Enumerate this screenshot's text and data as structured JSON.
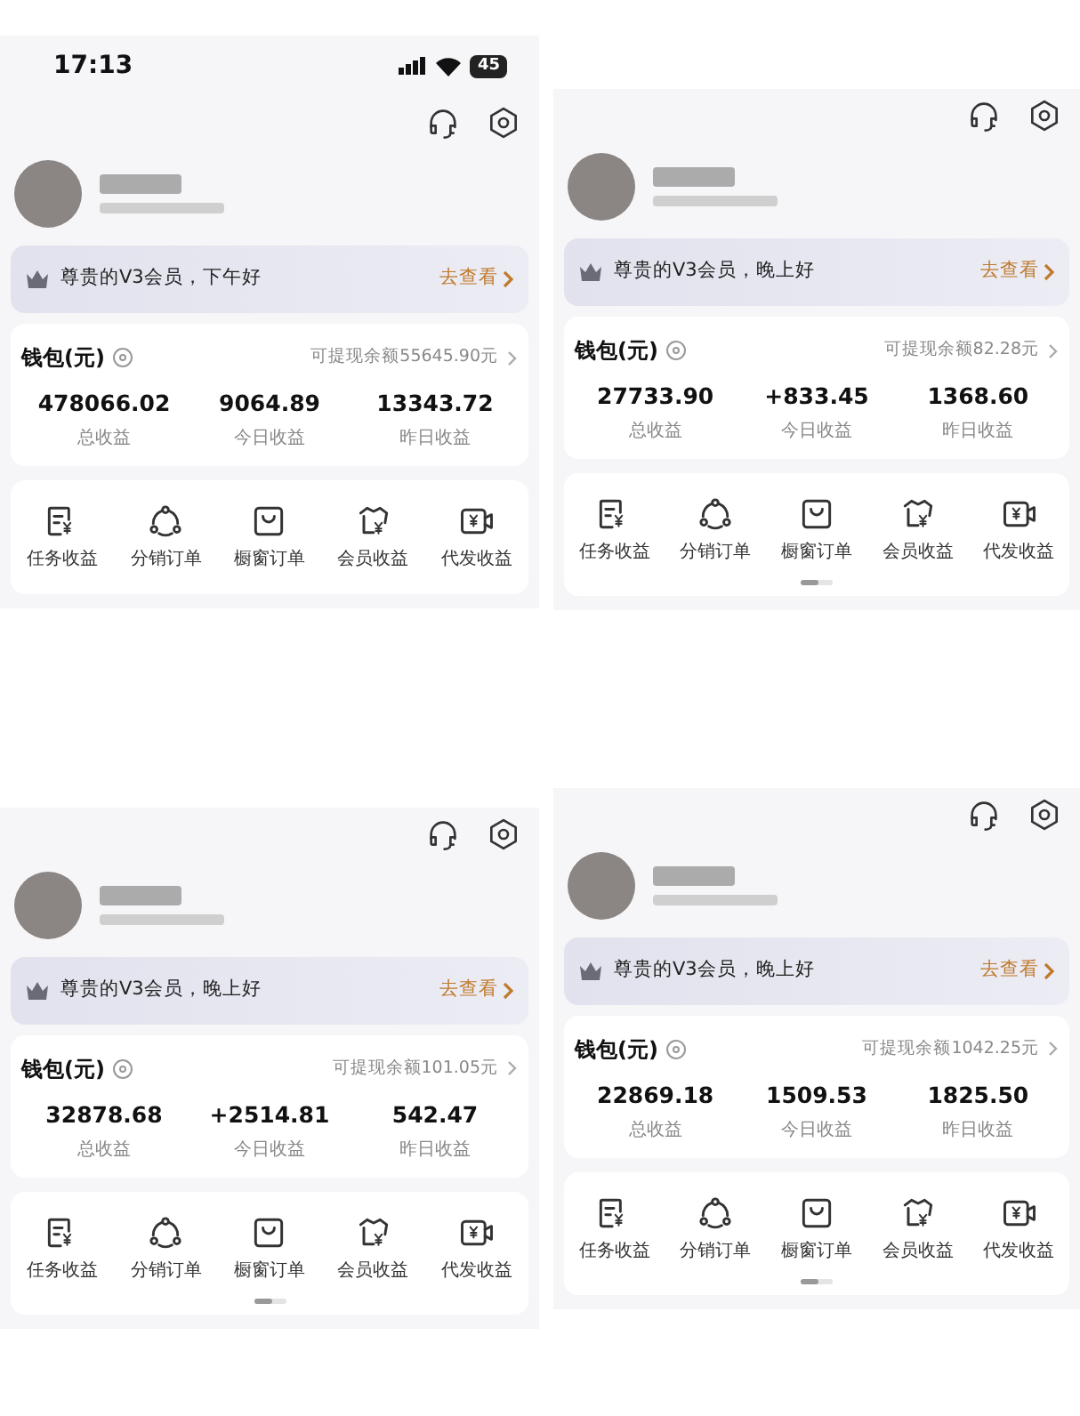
{
  "screens": [
    {
      "status_bar": {
        "time": "17:13",
        "battery": "45"
      },
      "greeting": "尊贵的V3会员，下午好",
      "link": "去查看",
      "wallet": {
        "title": "钱包(元)",
        "withdrawable": "可提现余额55645.90元",
        "stats": [
          {
            "value": "478066.02",
            "label": "总收益"
          },
          {
            "value": "9064.89",
            "label": "今日收益"
          },
          {
            "value": "13343.72",
            "label": "昨日收益"
          }
        ]
      },
      "shortcuts": [
        {
          "kind": "task",
          "label": "任务收益"
        },
        {
          "kind": "distribute",
          "label": "分销订单"
        },
        {
          "kind": "showcase",
          "label": "橱窗订单"
        },
        {
          "kind": "member",
          "label": "会员收益"
        },
        {
          "kind": "delivery",
          "label": "代发收益"
        }
      ],
      "page_indicator": false
    },
    {
      "greeting": "尊贵的V3会员，晚上好",
      "link": "去查看",
      "wallet": {
        "title": "钱包(元)",
        "withdrawable": "可提现余额82.28元",
        "stats": [
          {
            "value": "27733.90",
            "label": "总收益"
          },
          {
            "value": "+833.45",
            "label": "今日收益"
          },
          {
            "value": "1368.60",
            "label": "昨日收益"
          }
        ]
      },
      "shortcuts": [
        {
          "kind": "task",
          "label": "任务收益"
        },
        {
          "kind": "distribute",
          "label": "分销订单"
        },
        {
          "kind": "showcase",
          "label": "橱窗订单"
        },
        {
          "kind": "member",
          "label": "会员收益"
        },
        {
          "kind": "delivery",
          "label": "代发收益"
        }
      ],
      "page_indicator": true
    },
    {
      "greeting": "尊贵的V3会员，晚上好",
      "link": "去查看",
      "wallet": {
        "title": "钱包(元)",
        "withdrawable": "可提现余额101.05元",
        "stats": [
          {
            "value": "32878.68",
            "label": "总收益"
          },
          {
            "value": "+2514.81",
            "label": "今日收益"
          },
          {
            "value": "542.47",
            "label": "昨日收益"
          }
        ]
      },
      "shortcuts": [
        {
          "kind": "task",
          "label": "任务收益"
        },
        {
          "kind": "distribute",
          "label": "分销订单"
        },
        {
          "kind": "showcase",
          "label": "橱窗订单"
        },
        {
          "kind": "member",
          "label": "会员收益"
        },
        {
          "kind": "delivery",
          "label": "代发收益"
        }
      ],
      "page_indicator": true
    },
    {
      "greeting": "尊贵的V3会员，晚上好",
      "link": "去查看",
      "wallet": {
        "title": "钱包(元)",
        "withdrawable": "可提现余额1042.25元",
        "stats": [
          {
            "value": "22869.18",
            "label": "总收益"
          },
          {
            "value": "1509.53",
            "label": "今日收益"
          },
          {
            "value": "1825.50",
            "label": "昨日收益"
          }
        ]
      },
      "shortcuts": [
        {
          "kind": "task",
          "label": "任务收益"
        },
        {
          "kind": "distribute",
          "label": "分销订单"
        },
        {
          "kind": "showcase",
          "label": "橱窗订单"
        },
        {
          "kind": "member",
          "label": "会员收益"
        },
        {
          "kind": "delivery",
          "label": "代发收益"
        }
      ],
      "page_indicator": true
    }
  ]
}
